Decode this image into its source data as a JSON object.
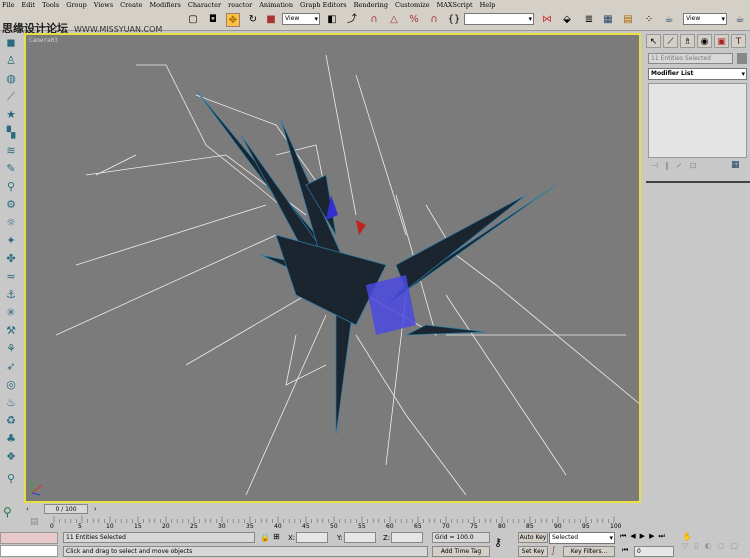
{
  "menu": [
    "File",
    "Edit",
    "Tools",
    "Group",
    "Views",
    "Create",
    "Modifiers",
    "Character",
    "reactor",
    "Animation",
    "Graph Editors",
    "Rendering",
    "Customize",
    "MAXScript",
    "Help"
  ],
  "watermark": {
    "cn": "思缘设计论坛",
    "url": "WWW.MISSYUAN.COM"
  },
  "toolbar": {
    "ref_coord": "View",
    "named_sel": "",
    "render_view": "View"
  },
  "viewport": {
    "label": "Camera03",
    "border_color": "#e8e040",
    "bg": "#7b7b7b"
  },
  "panel": {
    "selection_name": "11 Entities Selected",
    "modifier_list": "Modifier List"
  },
  "timeslider": {
    "position": "0 / 100",
    "ticks": [
      "0",
      "5",
      "10",
      "15",
      "20",
      "25",
      "30",
      "35",
      "40",
      "45",
      "50",
      "55",
      "60",
      "65",
      "70",
      "75",
      "80",
      "85",
      "90",
      "95",
      "100"
    ]
  },
  "status": {
    "selection": "11 Entities Selected",
    "prompt": "Click and drag to select and move objects",
    "x_label": "X:",
    "y_label": "Y:",
    "z_label": "Z:",
    "x": "",
    "y": "",
    "z": "",
    "grid": "Grid = 100.0",
    "add_time_tag": "Add Time Tag",
    "auto_key": "Auto Key",
    "set_key": "Set Key",
    "key_mode": "Selected",
    "key_filters": "Key Filters...",
    "frame": "0"
  }
}
